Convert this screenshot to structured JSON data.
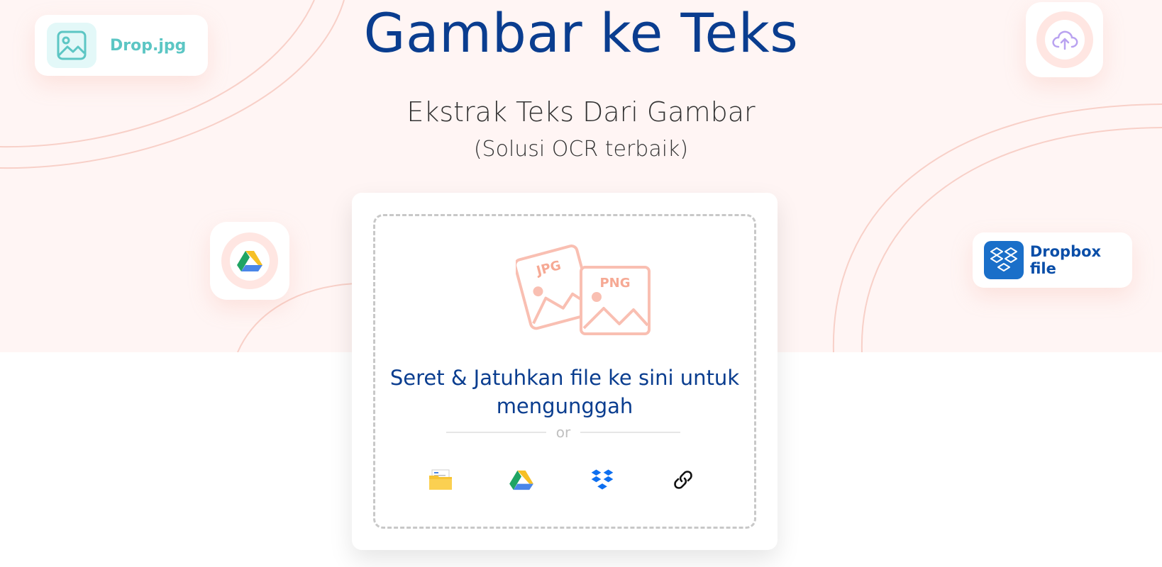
{
  "header": {
    "title": "Gambar ke Teks",
    "subtitle": "Ekstrak Teks Dari Gambar",
    "subtitle2": "(Solusi OCR terbaik)"
  },
  "floating": {
    "drop_label": "Drop.jpg",
    "dropbox_label": "Dropbox file",
    "icons": [
      "image-icon",
      "cloud-upload-icon",
      "google-drive-icon",
      "dropbox-icon"
    ]
  },
  "upload": {
    "jpg_tag": "JPG",
    "png_tag": "PNG",
    "drop_text": "Seret & Jatuhkan file ke sini untuk mengunggah",
    "or_label": "or",
    "sources": [
      "folder-icon",
      "google-drive-icon",
      "dropbox-icon",
      "link-icon"
    ]
  },
  "colors": {
    "title": "#0a3d8f",
    "hero_bg": "#fff5f4",
    "accent_pink": "#f9bfb2",
    "teal": "#5cc6c4",
    "dropbox_blue": "#1a6fc9"
  }
}
